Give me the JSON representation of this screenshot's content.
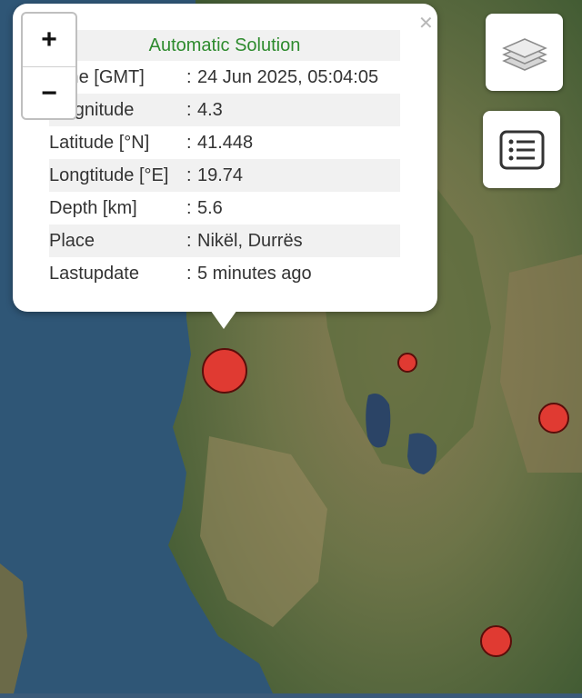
{
  "map": {
    "markers": [
      {
        "id": "selected",
        "color": "#e03a32"
      },
      {
        "id": "east-small",
        "color": "#e03a32"
      },
      {
        "id": "far-east",
        "color": "#e03a32"
      },
      {
        "id": "south-east",
        "color": "#e03a32"
      }
    ]
  },
  "popup": {
    "title": "Automatic Solution",
    "close_icon": "close-icon",
    "rows": [
      {
        "label": "Time [GMT]",
        "sep": ":",
        "value": "24 Jun 2025, 05:04:05"
      },
      {
        "label": "Magnitude",
        "sep": ":",
        "value": "4.3"
      },
      {
        "label": "Latitude [°N]",
        "sep": ":",
        "value": "41.448"
      },
      {
        "label": "Longtitude [°E]",
        "sep": ":",
        "value": "19.74"
      },
      {
        "label": "Depth [km]",
        "sep": ":",
        "value": "5.6"
      },
      {
        "label": "Place",
        "sep": ":",
        "value": "Nikël, Durrës"
      },
      {
        "label": "Lastupdate",
        "sep": ":",
        "value": "5 minutes ago"
      }
    ]
  },
  "controls": {
    "zoom_in": "+",
    "zoom_out": "−",
    "layers_icon": "layers-icon",
    "list_icon": "list-icon"
  },
  "colors": {
    "marker": "#e03a32",
    "title_green": "#2e8b2e"
  }
}
